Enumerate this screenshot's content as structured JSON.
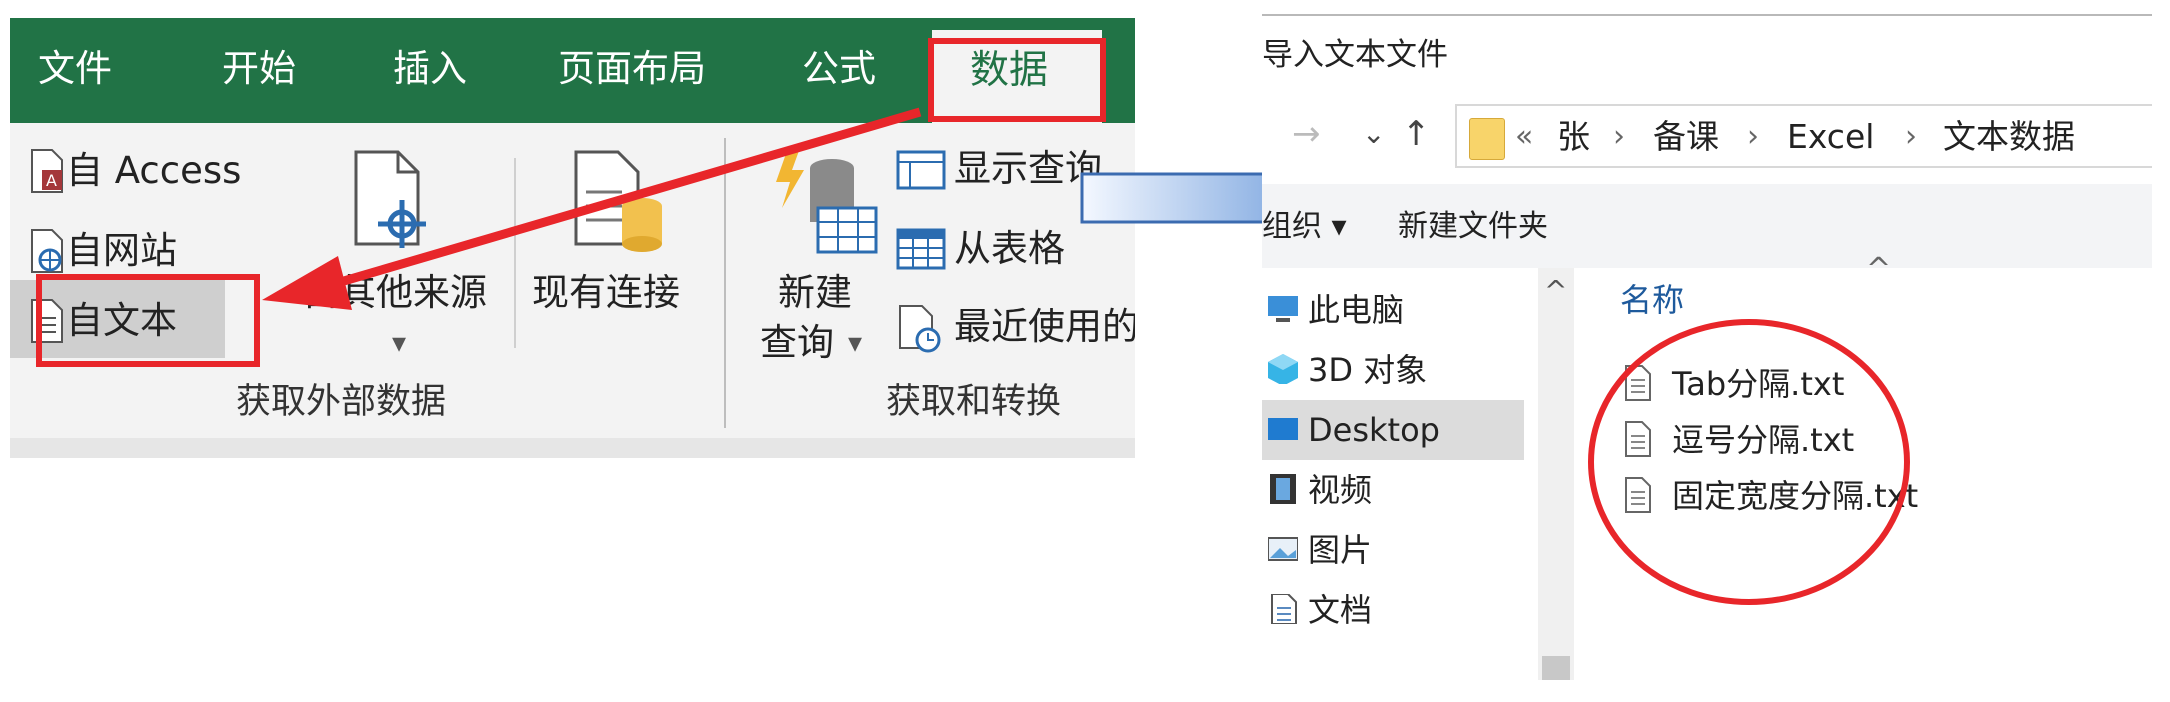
{
  "excel": {
    "tabs": [
      "文件",
      "开始",
      "插入",
      "页面布局",
      "公式",
      "数据"
    ],
    "selected_tab": "数据",
    "get_external_data": {
      "from_access": "自 Access",
      "from_web": "自网站",
      "from_text": "自文本",
      "from_other_sources": "自其他来源",
      "existing_connections": "现有连接",
      "group_label": "获取外部数据"
    },
    "get_transform": {
      "new_query_line1": "新建",
      "new_query_line2": "查询",
      "show_queries": "显示查询",
      "from_table": "从表格",
      "recent_sources": "最近使用的源",
      "group_label": "获取和转换"
    },
    "dropdown_caret": "▾"
  },
  "dialog": {
    "title": "导入文本文件",
    "nav": {
      "back": "→",
      "recent": "⌄",
      "up": "↑"
    },
    "address": {
      "overflow": "«",
      "sep": "›",
      "crumbs": [
        "张",
        "备课",
        "Excel",
        "文本数据"
      ]
    },
    "commands": {
      "organize": "组织 ▾",
      "new_folder": "新建文件夹"
    },
    "nav_pane": [
      "此电脑",
      "3D 对象",
      "Desktop",
      "视频",
      "图片",
      "文档"
    ],
    "selected_nav": "Desktop",
    "scroll_up": "^",
    "column_header": "名称",
    "sort_caret": "^",
    "files": [
      "Tab分隔.txt",
      "逗号分隔.txt",
      "固定宽度分隔.txt"
    ]
  },
  "colors": {
    "excel_green": "#217346",
    "highlight_red": "#e8262a",
    "arrow_blue": "#5b8fd6",
    "link_blue": "#1e5a9c"
  }
}
